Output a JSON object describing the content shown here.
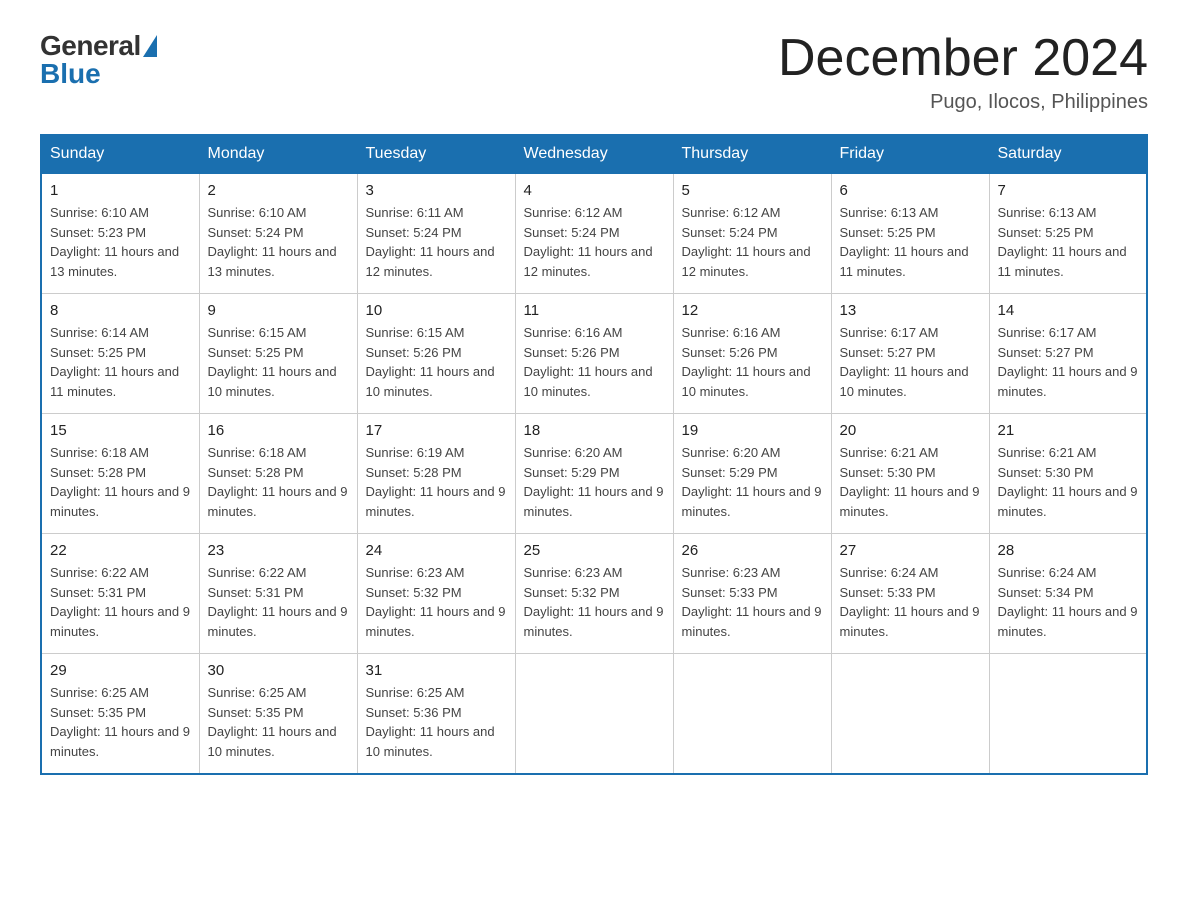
{
  "header": {
    "logo_general": "General",
    "logo_blue": "Blue",
    "month_title": "December 2024",
    "location": "Pugo, Ilocos, Philippines"
  },
  "days_of_week": [
    "Sunday",
    "Monday",
    "Tuesday",
    "Wednesday",
    "Thursday",
    "Friday",
    "Saturday"
  ],
  "weeks": [
    [
      {
        "day": "1",
        "sunrise": "6:10 AM",
        "sunset": "5:23 PM",
        "daylight": "11 hours and 13 minutes."
      },
      {
        "day": "2",
        "sunrise": "6:10 AM",
        "sunset": "5:24 PM",
        "daylight": "11 hours and 13 minutes."
      },
      {
        "day": "3",
        "sunrise": "6:11 AM",
        "sunset": "5:24 PM",
        "daylight": "11 hours and 12 minutes."
      },
      {
        "day": "4",
        "sunrise": "6:12 AM",
        "sunset": "5:24 PM",
        "daylight": "11 hours and 12 minutes."
      },
      {
        "day": "5",
        "sunrise": "6:12 AM",
        "sunset": "5:24 PM",
        "daylight": "11 hours and 12 minutes."
      },
      {
        "day": "6",
        "sunrise": "6:13 AM",
        "sunset": "5:25 PM",
        "daylight": "11 hours and 11 minutes."
      },
      {
        "day": "7",
        "sunrise": "6:13 AM",
        "sunset": "5:25 PM",
        "daylight": "11 hours and 11 minutes."
      }
    ],
    [
      {
        "day": "8",
        "sunrise": "6:14 AM",
        "sunset": "5:25 PM",
        "daylight": "11 hours and 11 minutes."
      },
      {
        "day": "9",
        "sunrise": "6:15 AM",
        "sunset": "5:25 PM",
        "daylight": "11 hours and 10 minutes."
      },
      {
        "day": "10",
        "sunrise": "6:15 AM",
        "sunset": "5:26 PM",
        "daylight": "11 hours and 10 minutes."
      },
      {
        "day": "11",
        "sunrise": "6:16 AM",
        "sunset": "5:26 PM",
        "daylight": "11 hours and 10 minutes."
      },
      {
        "day": "12",
        "sunrise": "6:16 AM",
        "sunset": "5:26 PM",
        "daylight": "11 hours and 10 minutes."
      },
      {
        "day": "13",
        "sunrise": "6:17 AM",
        "sunset": "5:27 PM",
        "daylight": "11 hours and 10 minutes."
      },
      {
        "day": "14",
        "sunrise": "6:17 AM",
        "sunset": "5:27 PM",
        "daylight": "11 hours and 9 minutes."
      }
    ],
    [
      {
        "day": "15",
        "sunrise": "6:18 AM",
        "sunset": "5:28 PM",
        "daylight": "11 hours and 9 minutes."
      },
      {
        "day": "16",
        "sunrise": "6:18 AM",
        "sunset": "5:28 PM",
        "daylight": "11 hours and 9 minutes."
      },
      {
        "day": "17",
        "sunrise": "6:19 AM",
        "sunset": "5:28 PM",
        "daylight": "11 hours and 9 minutes."
      },
      {
        "day": "18",
        "sunrise": "6:20 AM",
        "sunset": "5:29 PM",
        "daylight": "11 hours and 9 minutes."
      },
      {
        "day": "19",
        "sunrise": "6:20 AM",
        "sunset": "5:29 PM",
        "daylight": "11 hours and 9 minutes."
      },
      {
        "day": "20",
        "sunrise": "6:21 AM",
        "sunset": "5:30 PM",
        "daylight": "11 hours and 9 minutes."
      },
      {
        "day": "21",
        "sunrise": "6:21 AM",
        "sunset": "5:30 PM",
        "daylight": "11 hours and 9 minutes."
      }
    ],
    [
      {
        "day": "22",
        "sunrise": "6:22 AM",
        "sunset": "5:31 PM",
        "daylight": "11 hours and 9 minutes."
      },
      {
        "day": "23",
        "sunrise": "6:22 AM",
        "sunset": "5:31 PM",
        "daylight": "11 hours and 9 minutes."
      },
      {
        "day": "24",
        "sunrise": "6:23 AM",
        "sunset": "5:32 PM",
        "daylight": "11 hours and 9 minutes."
      },
      {
        "day": "25",
        "sunrise": "6:23 AM",
        "sunset": "5:32 PM",
        "daylight": "11 hours and 9 minutes."
      },
      {
        "day": "26",
        "sunrise": "6:23 AM",
        "sunset": "5:33 PM",
        "daylight": "11 hours and 9 minutes."
      },
      {
        "day": "27",
        "sunrise": "6:24 AM",
        "sunset": "5:33 PM",
        "daylight": "11 hours and 9 minutes."
      },
      {
        "day": "28",
        "sunrise": "6:24 AM",
        "sunset": "5:34 PM",
        "daylight": "11 hours and 9 minutes."
      }
    ],
    [
      {
        "day": "29",
        "sunrise": "6:25 AM",
        "sunset": "5:35 PM",
        "daylight": "11 hours and 9 minutes."
      },
      {
        "day": "30",
        "sunrise": "6:25 AM",
        "sunset": "5:35 PM",
        "daylight": "11 hours and 10 minutes."
      },
      {
        "day": "31",
        "sunrise": "6:25 AM",
        "sunset": "5:36 PM",
        "daylight": "11 hours and 10 minutes."
      },
      null,
      null,
      null,
      null
    ]
  ],
  "cell_labels": {
    "sunrise": "Sunrise:",
    "sunset": "Sunset:",
    "daylight": "Daylight:"
  }
}
